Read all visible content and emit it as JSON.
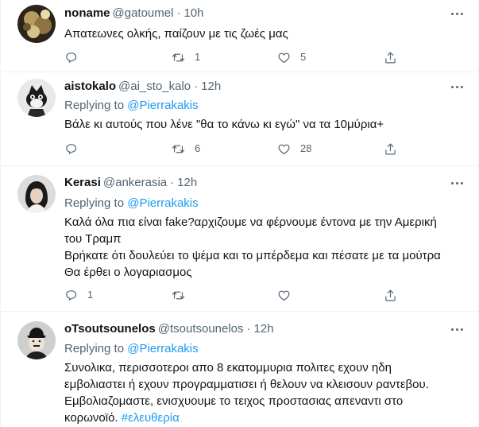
{
  "tweets": [
    {
      "name": "noname",
      "handle": "@gatoumel",
      "time": "10h",
      "reply_prefix": "",
      "reply_to": "",
      "lines": [
        "Απατεωνες ολκής, παίζουν με τις ζωές μας"
      ],
      "hashtag": "",
      "replies": "",
      "retweets": "1",
      "likes": "5",
      "avatar_icon": "brass-chandelier-photo"
    },
    {
      "name": "aistokalo",
      "handle": "@ai_sto_kalo",
      "time": "12h",
      "reply_prefix": "Replying to",
      "reply_to": "@Pierrakakis",
      "lines": [
        "Βάλε κι αυτούς που λένε \"θα το κάνω κι εγώ\" να τα 10μύρια+"
      ],
      "hashtag": "",
      "replies": "",
      "retweets": "6",
      "likes": "28",
      "avatar_icon": "cartoon-cat-photo"
    },
    {
      "name": "Kerasi",
      "handle": "@ankerasia",
      "time": "12h",
      "reply_prefix": "Replying to",
      "reply_to": "@Pierrakakis",
      "lines": [
        "Καλά όλα πια είναι fake?αρχιζουμε να φέρνουμε  έντονα με την Αμερική",
        "του Τραμπ",
        "Βρήκατε ότι δουλεύει το  ψέμα και το μπέρδεμα και πέσατε με τα μούτρα",
        "Θα έρθει ο λογαριασμος"
      ],
      "hashtag": "",
      "replies": "1",
      "retweets": "",
      "likes": "",
      "avatar_icon": "woman-portrait-photo"
    },
    {
      "name": "oTsoutsounelos",
      "handle": "@tsoutsounelos",
      "time": "12h",
      "reply_prefix": "Replying to",
      "reply_to": "@Pierrakakis",
      "lines": [
        "Συνολικα, περισσοτεροι απο 8 εκατομμυρια πολιτες εχουν ηδη",
        "εμβολιαστει ή εχουν προγραμματισει ή θελουν να κλεισουν ραντεβου.",
        "Εμβολιαζομαστε, ενισχυουμε το τειχος προστασιας απεναντι στο",
        "κορωνοϊό."
      ],
      "hashtag": "#ελευθερία",
      "replies": "",
      "retweets": "",
      "likes": "",
      "avatar_icon": "man-bowler-hat-photo"
    }
  ],
  "icons": {
    "reply": "reply-icon",
    "retweet": "retweet-icon",
    "like": "heart-icon",
    "share": "share-icon",
    "more": "more-options-icon"
  },
  "colors": {
    "text": "#0f1419",
    "muted": "#536471",
    "link": "#1d9bf0",
    "divider": "#eff3f4"
  }
}
